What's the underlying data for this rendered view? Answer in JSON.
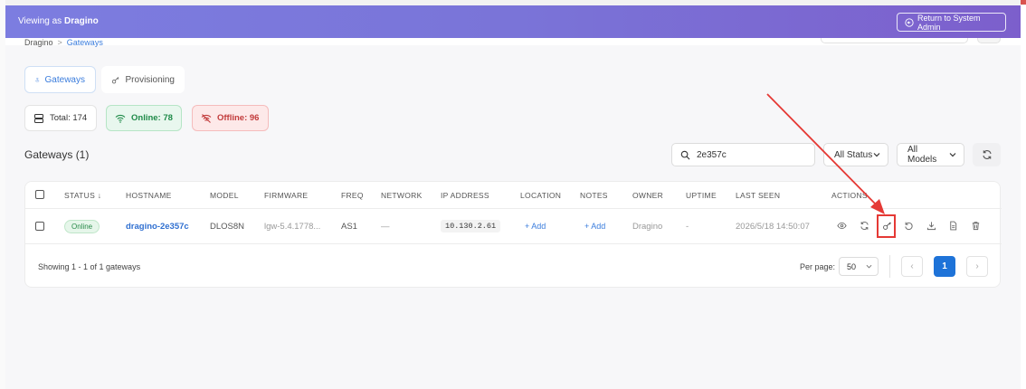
{
  "banner": {
    "viewing_prefix": "Viewing as ",
    "viewing_org": "Dragino",
    "return_label": "Return to System Admin"
  },
  "breadcrumb": {
    "root": "Dragino",
    "separator": ">",
    "current": "Gateways"
  },
  "tabs": [
    {
      "label": "Gateways",
      "icon": "gateway-icon",
      "active": true
    },
    {
      "label": "Provisioning",
      "icon": "key-icon",
      "active": false
    }
  ],
  "stats": {
    "total": "Total: 174",
    "online": "Online: 78",
    "offline": "Offline: 96"
  },
  "section_title": "Gateways (1)",
  "filters": {
    "search_value": "2e357c",
    "status": "All Status",
    "models": "All Models"
  },
  "table": {
    "headers": [
      "STATUS",
      "HOSTNAME",
      "MODEL",
      "FIRMWARE",
      "FREQ",
      "NETWORK",
      "IP ADDRESS",
      "LOCATION",
      "NOTES",
      "OWNER",
      "UPTIME",
      "LAST SEEN",
      "ACTIONS"
    ],
    "sort_indicator": "↓",
    "rows": [
      {
        "status": "Online",
        "hostname": "dragino-2e357c",
        "model": "DLOS8N",
        "firmware": "lgw-5.4.1778...",
        "freq": "AS1",
        "network": "—",
        "ip": "10.130.2.61",
        "location": "+ Add",
        "notes": "+ Add",
        "owner": "Dragino",
        "uptime": "-",
        "last_seen": "2026/5/18 14:50:07"
      }
    ],
    "actions": [
      "eye-icon",
      "refresh-icon",
      "key-icon",
      "undo-icon",
      "download-icon",
      "file-icon",
      "trash-icon"
    ]
  },
  "footer": {
    "showing": "Showing 1 - 1 of 1 gateways",
    "per_page_label": "Per page:",
    "per_page_value": "50",
    "prev": "‹",
    "current_page": "1",
    "next": "›"
  },
  "colors": {
    "banner_gradient_start": "#7c7de0",
    "banner_gradient_end": "#7c5fcc",
    "accent": "#1e73d8",
    "online": "#1e8a48",
    "offline": "#c23b3b",
    "annotation": "#e53935"
  }
}
